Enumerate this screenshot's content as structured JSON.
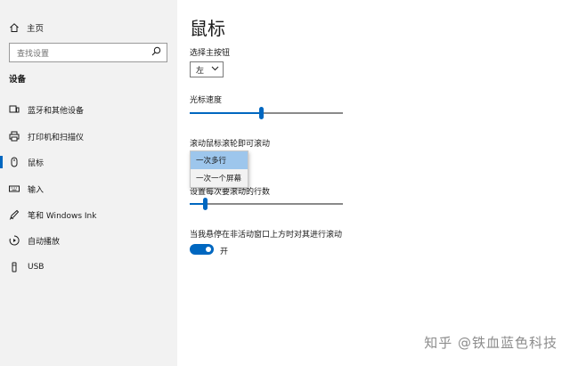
{
  "sidebar": {
    "home_label": "主页",
    "search_placeholder": "查找设置",
    "section_title": "设备",
    "items": [
      {
        "label": "蓝牙和其他设备",
        "icon": "bluetooth-devices-icon"
      },
      {
        "label": "打印机和扫描仪",
        "icon": "printer-icon"
      },
      {
        "label": "鼠标",
        "icon": "mouse-icon",
        "active": true
      },
      {
        "label": "输入",
        "icon": "keyboard-icon"
      },
      {
        "label": "笔和 Windows Ink",
        "icon": "pen-icon"
      },
      {
        "label": "自动播放",
        "icon": "autoplay-icon"
      },
      {
        "label": "USB",
        "icon": "usb-icon"
      }
    ]
  },
  "main": {
    "title": "鼠标",
    "primary_button": {
      "label": "选择主按钮",
      "value": "左"
    },
    "cursor_speed": {
      "label": "光标速度",
      "value": 0.47
    },
    "scroll_mode": {
      "label": "滚动鼠标滚轮即可滚动",
      "options": [
        "一次多行",
        "一次一个屏幕"
      ],
      "selected": "一次多行"
    },
    "lines_per_scroll": {
      "label": "设置每次要滚动的行数",
      "value": 0.1
    },
    "inactive_scroll": {
      "label": "当我悬停在非活动窗口上方时对其进行滚动",
      "state": "开",
      "on": true
    }
  },
  "watermark": "知乎 @铁血蓝色科技",
  "colors": {
    "accent": "#0067c0",
    "sidebar_bg": "#f2f2f2",
    "dropdown_selected": "#9dc6ec"
  }
}
